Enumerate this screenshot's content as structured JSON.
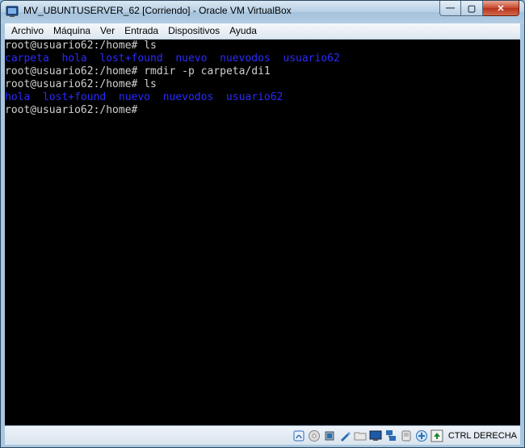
{
  "window": {
    "title": "MV_UBUNTUSERVER_62 [Corriendo] - Oracle VM VirtualBox",
    "minimize_label": "—",
    "maximize_label": "▢",
    "close_label": "✕"
  },
  "menubar": {
    "items": [
      "Archivo",
      "Máquina",
      "Ver",
      "Entrada",
      "Dispositivos",
      "Ayuda"
    ]
  },
  "terminal": {
    "lines": [
      {
        "prompt": "root@usuario62:/home#",
        "cmd": " ls",
        "dirs": ""
      },
      {
        "prompt": "",
        "cmd": "",
        "dirs": "carpeta  hola  lost+found  nuevo  nuevodos  usuario62"
      },
      {
        "prompt": "root@usuario62:/home#",
        "cmd": " rmdir -p carpeta/di1",
        "dirs": ""
      },
      {
        "prompt": "root@usuario62:/home#",
        "cmd": " ls",
        "dirs": ""
      },
      {
        "prompt": "",
        "cmd": "",
        "dirs": "hola  lost+found  nuevo  nuevodos  usuario62"
      },
      {
        "prompt": "root@usuario62:/home#",
        "cmd": "",
        "dirs": ""
      }
    ]
  },
  "statusbar": {
    "icons": [
      "hard-disk-icon",
      "optical-drive-icon",
      "usb-icon",
      "shared-folder-pencil-icon",
      "shared-folder-icon",
      "display-icon",
      "network-icon",
      "recording-icon",
      "mouse-integration-icon",
      "capture-arrow-icon"
    ],
    "host_key": "CTRL DERECHA"
  },
  "colors": {
    "terminal_bg": "#000000",
    "terminal_text": "#d0d0d0",
    "directory_text": "#2a2aff"
  }
}
